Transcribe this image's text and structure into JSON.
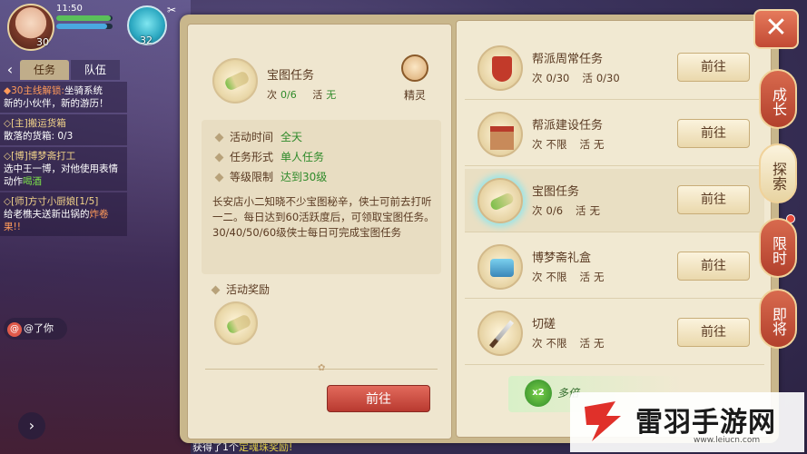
{
  "status": {
    "time": "11:50",
    "avatar_level": "30",
    "pet_level": "32"
  },
  "colors": {
    "accent_green": "#2f8a2a",
    "button_red": "#c23a2a",
    "panel": "#efe6cf"
  },
  "tabs": {
    "task": "任务",
    "team": "队伍"
  },
  "tasks": [
    {
      "prefix": "◆30主线解锁:",
      "title": "坐骑系统",
      "body": "新的小伙伴，新的游历！"
    },
    {
      "prefix": "◇[主]",
      "title": "搬运货箱",
      "body": "散落的货箱: 0/3"
    },
    {
      "prefix": "◇[博]",
      "title": "博梦斋打工",
      "body": "选中王一博，对他使用表情动作",
      "hl": "喝酒"
    },
    {
      "prefix": "◇[师]",
      "title": "方寸小厨娘[1/5]",
      "body": "给老樵夫送新出锅的",
      "hl": "炸卷果!!"
    }
  ],
  "chat": {
    "label": "@了你"
  },
  "bottom_msg": {
    "text": "获得了1个",
    "hl": "定魂珠奖励!"
  },
  "detail": {
    "title": "宝图任务",
    "count_label": "次",
    "count_value": "0/6",
    "active_label": "活",
    "active_value": "无",
    "sprite_label": "精灵",
    "info": [
      {
        "k": "活动时间",
        "v": "全天"
      },
      {
        "k": "任务形式",
        "v": "单人任务"
      },
      {
        "k": "等级限制",
        "v": "达到30级"
      }
    ],
    "description": "长安店小二知晓不少宝图秘辛，侠士可前去打听一二。每日达到60活跃度后，可领取宝图任务。30/40/50/60级侠士每日可完成宝图任务",
    "reward_label": "活动奖励",
    "go_label": "前往"
  },
  "list": [
    {
      "icon": "guild-flag-icon",
      "title": "帮派周常任务",
      "count_label": "次",
      "count_value": "0/30",
      "active_label": "活",
      "active_value": "0/30",
      "btn": "前往"
    },
    {
      "icon": "guild-house-icon",
      "title": "帮派建设任务",
      "count_label": "次",
      "count_value": "不限",
      "active_label": "活",
      "active_value": "无",
      "btn": "前往"
    },
    {
      "icon": "treasure-scroll-icon",
      "title": "宝图任务",
      "count_label": "次",
      "count_value": "0/6",
      "active_label": "活",
      "active_value": "无",
      "btn": "前往"
    },
    {
      "icon": "gift-chest-icon",
      "title": "博梦斋礼盒",
      "count_label": "次",
      "count_value": "不限",
      "active_label": "活",
      "active_value": "无",
      "btn": "前往"
    },
    {
      "icon": "sword-icon",
      "title": "切磋",
      "count_label": "次",
      "count_value": "不限",
      "active_label": "活",
      "active_value": "无",
      "btn": "前往"
    }
  ],
  "multi": {
    "badge": "x2",
    "label": "多倍"
  },
  "side_tabs": [
    "成长",
    "探索",
    "限时",
    "即将"
  ],
  "watermark": {
    "text": "雷羽手游网",
    "url": "www.leiucn.com"
  }
}
